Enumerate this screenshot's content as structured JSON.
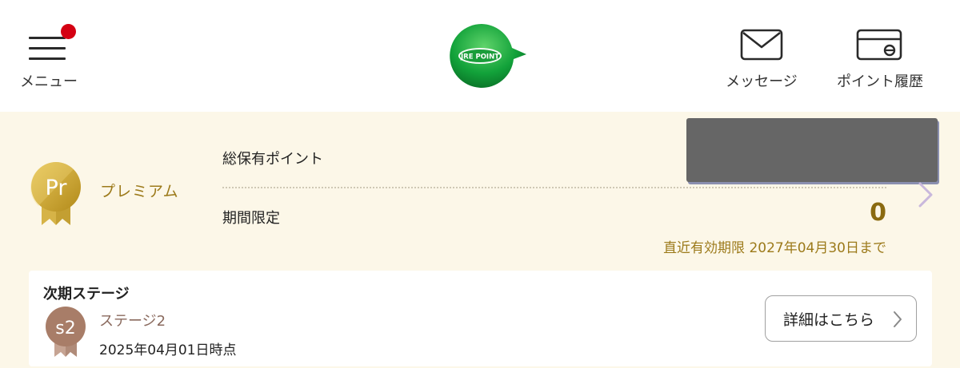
{
  "header": {
    "menu_label": "メニュー",
    "logo_text": "JRE POINT",
    "message_label": "メッセージ",
    "history_label": "ポイント履歴",
    "notification_color": "#d40012"
  },
  "points": {
    "rank_name": "プレミアム",
    "rank_badge_text": "Pr",
    "total_label": "総保有ポイント",
    "limited_label": "期間限定",
    "limited_value": "0",
    "expiry_text": "直近有効期限 2027年04月30日まで",
    "accent_color": "#9c7a1a"
  },
  "next_stage": {
    "title": "次期ステージ",
    "badge_text": "s2",
    "stage_name": "ステージ2",
    "as_of": "2025年04月01日時点",
    "detail_button": "詳細はこちら"
  },
  "icons": {
    "menu": "hamburger-icon",
    "message": "envelope-icon",
    "history": "card-icon",
    "next": "chevron-right-icon"
  }
}
